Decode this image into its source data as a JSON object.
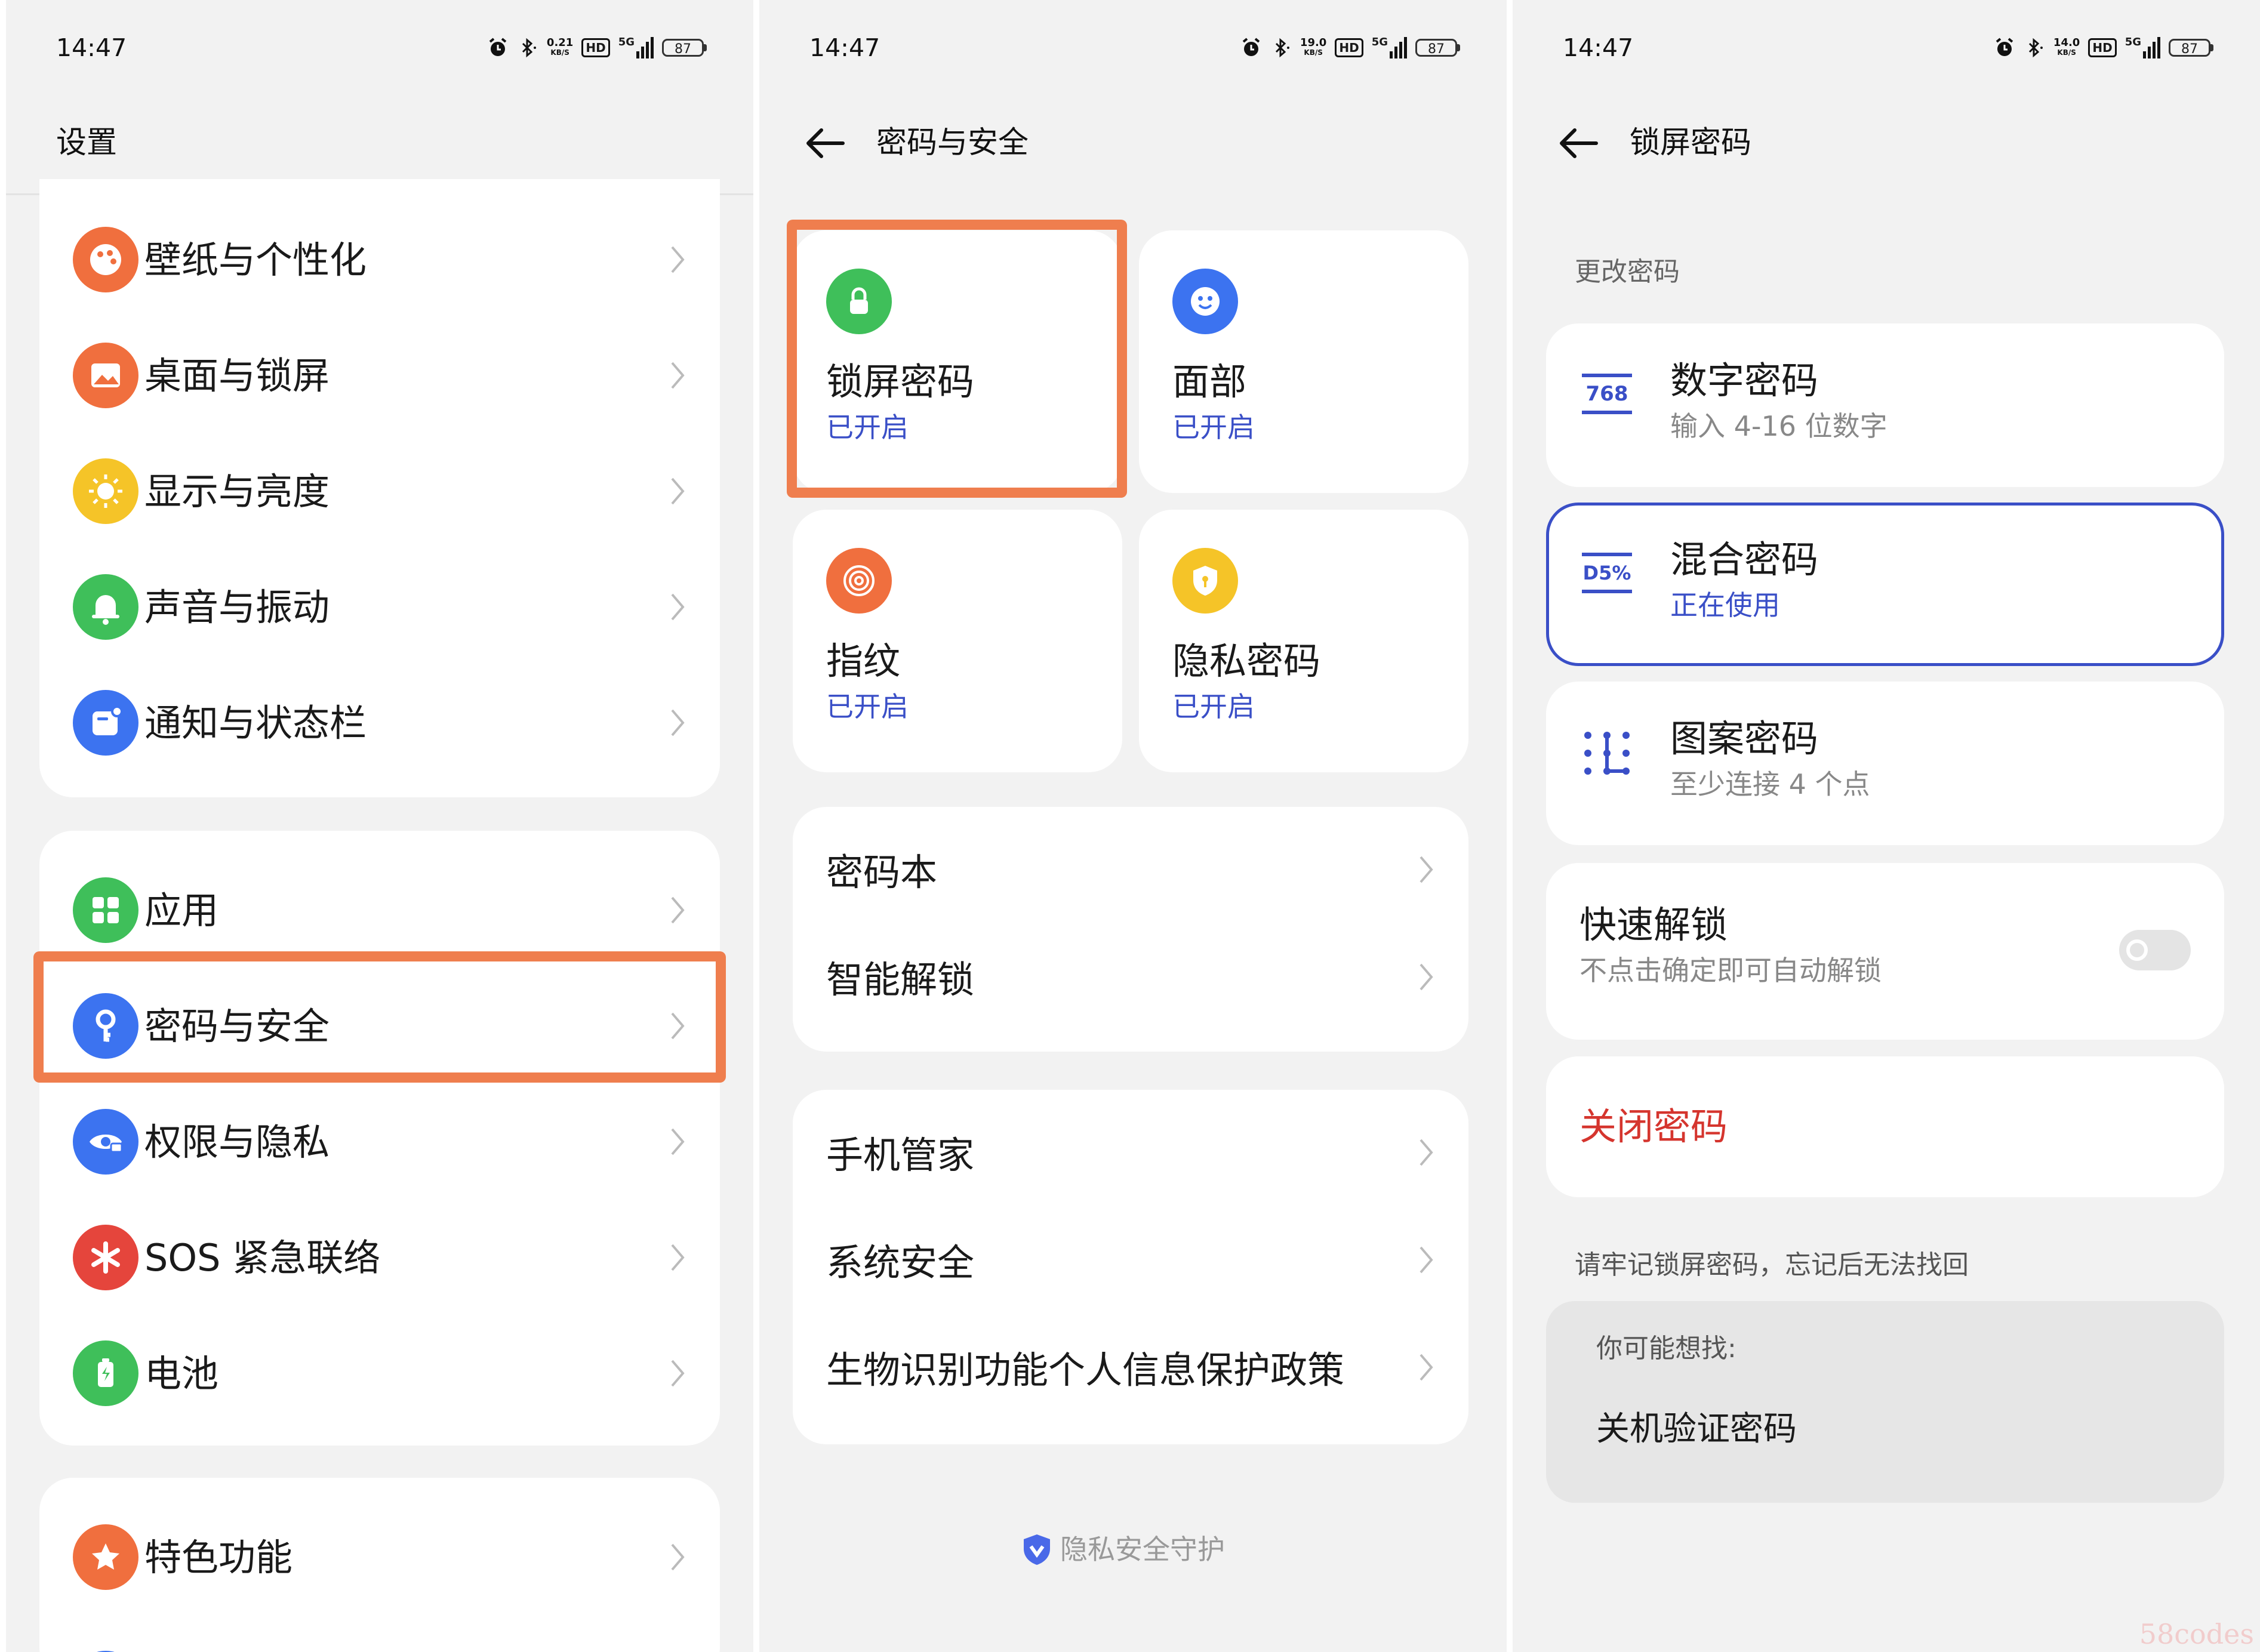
{
  "status": {
    "time": "14:47",
    "speeds": [
      "0.21",
      "19.0",
      "14.0"
    ],
    "speed_unit": "KB/S",
    "hd": "HD",
    "net": "5G",
    "battery": "87"
  },
  "settings": {
    "title": "设置",
    "groups": [
      [
        {
          "label": "壁纸与个性化",
          "icon": "palette-icon",
          "color": "#f06f3e"
        },
        {
          "label": "桌面与锁屏",
          "icon": "picture-icon",
          "color": "#f06f3e"
        },
        {
          "label": "显示与亮度",
          "icon": "sun-icon",
          "color": "#f5c428"
        },
        {
          "label": "声音与振动",
          "icon": "bell-icon",
          "color": "#3fbf5a"
        },
        {
          "label": "通知与状态栏",
          "icon": "notification-icon",
          "color": "#3c73f0"
        }
      ],
      [
        {
          "label": "应用",
          "icon": "apps-grid-icon",
          "color": "#3fbf5a"
        },
        {
          "label": "密码与安全",
          "icon": "key-icon",
          "color": "#3c73f0"
        },
        {
          "label": "权限与隐私",
          "icon": "privacy-eye-icon",
          "color": "#3c73f0"
        },
        {
          "label": "SOS 紧急联络",
          "icon": "asterisk-icon",
          "color": "#e5453c"
        },
        {
          "label": "电池",
          "icon": "battery-icon",
          "color": "#3fbf5a"
        }
      ],
      [
        {
          "label": "特色功能",
          "icon": "star-icon",
          "color": "#f06f3e"
        }
      ]
    ]
  },
  "security": {
    "title": "密码与安全",
    "tiles": [
      {
        "label": "锁屏密码",
        "status": "已开启",
        "icon": "lock-icon",
        "color": "#3fbf5a"
      },
      {
        "label": "面部",
        "status": "已开启",
        "icon": "face-icon",
        "color": "#3c73f0"
      },
      {
        "label": "指纹",
        "status": "已开启",
        "icon": "fingerprint-icon",
        "color": "#f06f3e"
      },
      {
        "label": "隐私密码",
        "status": "已开启",
        "icon": "shield-icon",
        "color": "#f5c428"
      }
    ],
    "list1": [
      "密码本",
      "智能解锁"
    ],
    "list2": [
      "手机管家",
      "系统安全",
      "生物识别功能个人信息保护政策"
    ],
    "footer": "隐私安全守护"
  },
  "lockscreen": {
    "title": "锁屏密码",
    "section_label": "更改密码",
    "options": [
      {
        "name": "数字密码",
        "sub": "输入 4-16 位数字",
        "icon_text": "768"
      },
      {
        "name": "混合密码",
        "sub": "正在使用",
        "icon_text": "D5%"
      },
      {
        "name": "图案密码",
        "sub": "至少连接 4 个点",
        "icon_text": ""
      }
    ],
    "quick_unlock": {
      "label": "快速解锁",
      "sub": "不点击确定即可自动解锁",
      "enabled": false
    },
    "close_label": "关闭密码",
    "note": "请牢记锁屏密码，忘记后无法找回",
    "suggest_title": "你可能想找:",
    "suggest_item": "关机验证密码"
  },
  "colors": {
    "highlight": "#ef7e4e",
    "accent": "#3a4fc7",
    "danger": "#d5352e"
  },
  "watermark": "58codes"
}
